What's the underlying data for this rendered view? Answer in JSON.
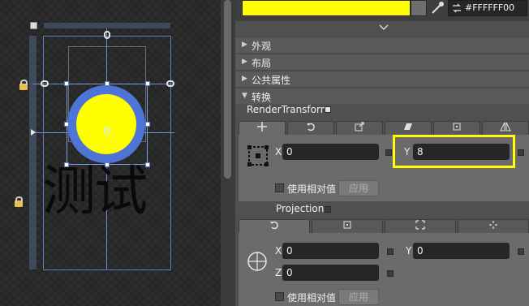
{
  "canvas": {
    "preview_text": "测试",
    "ellipse_fill": "#FFFF00",
    "ellipse_stroke": "#4F74D8"
  },
  "color": {
    "swatch": "#FFFF00",
    "hex_value": "#FFFFFF00",
    "eyedropper_icon": "eyedropper-icon",
    "swap_icon": "swap-icon"
  },
  "sections": [
    {
      "label": "外观",
      "expanded": false
    },
    {
      "label": "布局",
      "expanded": false
    },
    {
      "label": "公共属性",
      "expanded": false
    },
    {
      "label": "转换",
      "expanded": true
    }
  ],
  "render_transform": {
    "label": "RenderTransform",
    "tabs": [
      {
        "icon": "move-icon",
        "active": true
      },
      {
        "icon": "rotate-icon",
        "active": false
      },
      {
        "icon": "scale-icon",
        "active": false
      },
      {
        "icon": "skew-icon",
        "active": false
      },
      {
        "icon": "center-point-icon",
        "active": false
      },
      {
        "icon": "flip-icon",
        "active": false
      }
    ],
    "x_label": "X",
    "x_value": "0",
    "y_label": "Y",
    "y_value": "8",
    "relative_label": "使用相对值",
    "apply_label": "应用"
  },
  "projection": {
    "label": "Projection",
    "tabs": [
      {
        "icon": "rotate-icon",
        "active": true
      },
      {
        "icon": "center-point-icon",
        "active": false
      },
      {
        "icon": "global-offset-icon",
        "active": false
      },
      {
        "icon": "local-offset-icon",
        "active": false
      }
    ],
    "x_label": "X",
    "x_value": "0",
    "y_label": "Y",
    "y_value": "0",
    "z_label": "Z",
    "z_value": "0",
    "relative_label": "使用相对值",
    "apply_label": "应用"
  },
  "highlight_color": "#FFFF00"
}
